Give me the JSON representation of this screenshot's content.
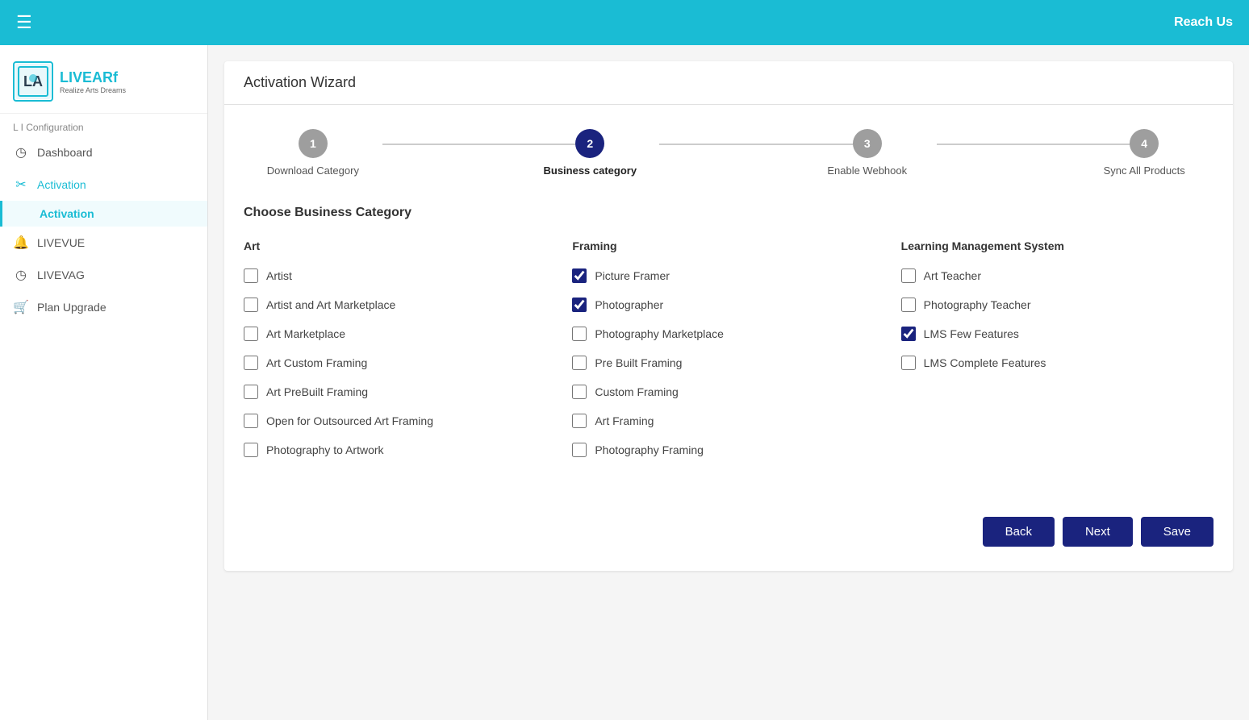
{
  "topbar": {
    "hamburger_label": "☰",
    "reach_us_label": "Reach Us"
  },
  "sidebar": {
    "config_label": "L I Configuration",
    "logo_name_part1": "LIVE",
    "logo_name_part2": "ARf",
    "logo_tagline": "Realize Arts Dreams",
    "items": [
      {
        "id": "dashboard",
        "label": "Dashboard",
        "icon": "◷"
      },
      {
        "id": "activation",
        "label": "Activation",
        "icon": "✂"
      },
      {
        "id": "activation-sub",
        "label": "Activation",
        "sub": true
      },
      {
        "id": "livevue",
        "label": "LIVEVUE",
        "icon": "🔔"
      },
      {
        "id": "livevag",
        "label": "LIVEVAG",
        "icon": "◷"
      },
      {
        "id": "plan-upgrade",
        "label": "Plan Upgrade",
        "icon": "🛒"
      }
    ]
  },
  "page": {
    "title": "Activation Wizard"
  },
  "wizard": {
    "steps": [
      {
        "number": "1",
        "label": "Download Category",
        "state": "inactive"
      },
      {
        "number": "2",
        "label": "Business category",
        "state": "active"
      },
      {
        "number": "3",
        "label": "Enable Webhook",
        "state": "inactive"
      },
      {
        "number": "4",
        "label": "Sync All Products",
        "state": "inactive"
      }
    ]
  },
  "business_category": {
    "section_title": "Choose Business Category",
    "columns": [
      {
        "title": "Art",
        "items": [
          {
            "label": "Artist",
            "checked": false
          },
          {
            "label": "Artist and Art Marketplace",
            "checked": false
          },
          {
            "label": "Art Marketplace",
            "checked": false
          },
          {
            "label": "Art Custom Framing",
            "checked": false
          },
          {
            "label": "Art PreBuilt Framing",
            "checked": false
          },
          {
            "label": "Open for Outsourced Art Framing",
            "checked": false
          },
          {
            "label": "Photography to Artwork",
            "checked": false
          }
        ]
      },
      {
        "title": "Framing",
        "items": [
          {
            "label": "Picture Framer",
            "checked": true
          },
          {
            "label": "Photographer",
            "checked": true
          },
          {
            "label": "Photography Marketplace",
            "checked": false
          },
          {
            "label": "Pre Built Framing",
            "checked": false
          },
          {
            "label": "Custom Framing",
            "checked": false
          },
          {
            "label": "Art Framing",
            "checked": false
          },
          {
            "label": "Photography Framing",
            "checked": false
          }
        ]
      },
      {
        "title": "Learning Management System",
        "items": [
          {
            "label": "Art Teacher",
            "checked": false
          },
          {
            "label": "Photography Teacher",
            "checked": false
          },
          {
            "label": "LMS Few Features",
            "checked": true
          },
          {
            "label": "LMS Complete Features",
            "checked": false
          }
        ]
      }
    ]
  },
  "actions": {
    "back_label": "Back",
    "next_label": "Next",
    "save_label": "Save"
  }
}
